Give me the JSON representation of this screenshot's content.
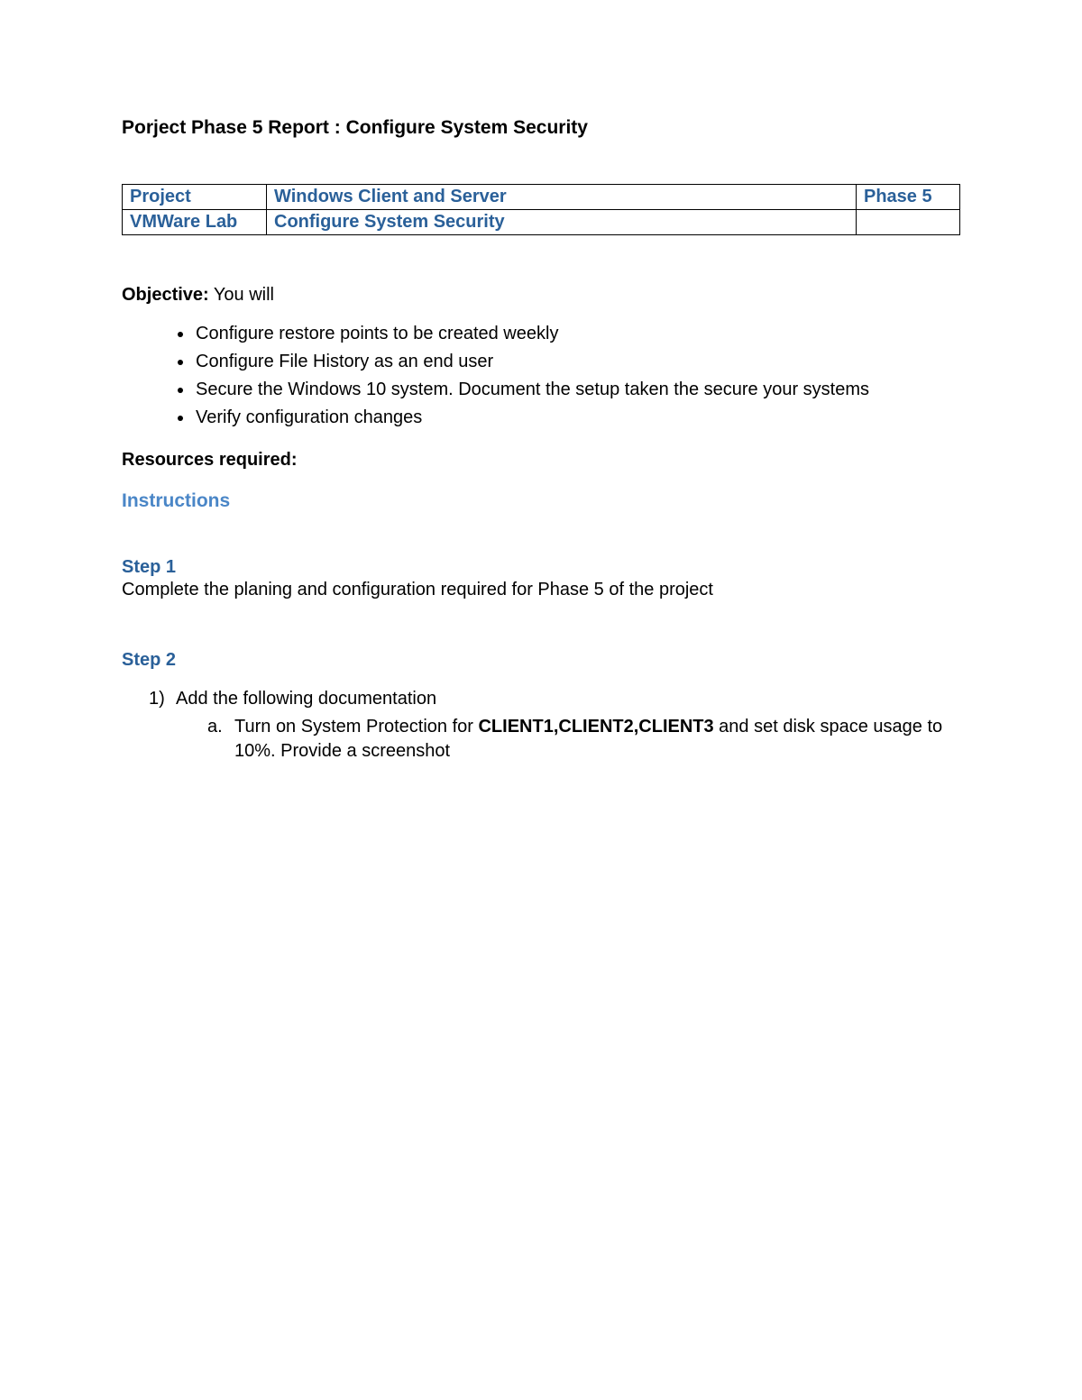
{
  "title": "Porject Phase 5 Report :  Configure System Security",
  "table": {
    "row1": {
      "c1": "Project",
      "c2": "Windows Client and Server",
      "c3": "Phase 5"
    },
    "row2": {
      "c1": "VMWare Lab",
      "c2": "Configure System Security",
      "c3": ""
    }
  },
  "objective": {
    "label": "Objective:",
    "tail": " You will",
    "items": [
      "Configure restore points to be created weekly",
      "Configure File History as an end user",
      "Secure the Windows 10 system.  Document the setup taken the secure your systems",
      "Verify configuration changes"
    ]
  },
  "resources_label": "Resources required:",
  "instructions_heading": "Instructions",
  "step1": {
    "heading": "Step 1",
    "text": "Complete the planing and configuration required for Phase 5 of the project"
  },
  "step2": {
    "heading": "Step 2",
    "item1_num": "1)",
    "item1_text": "Add the following documentation",
    "sub_a_letter": "a.",
    "sub_a_pre": "Turn on System Protection for ",
    "sub_a_bold": "CLIENT1,CLIENT2,CLIENT3",
    "sub_a_post": " and set disk space usage to 10%. Provide a screenshot"
  }
}
